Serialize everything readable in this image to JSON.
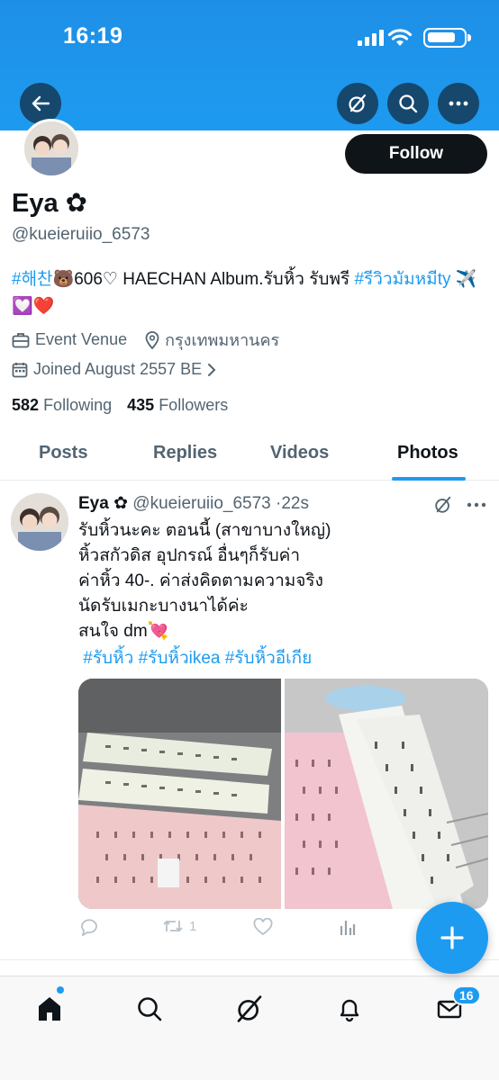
{
  "status_bar": {
    "time": "16:19",
    "battery_level": 0.78
  },
  "header": {
    "back_icon": "arrow-left-icon",
    "grok_icon": "grok-icon",
    "search_icon": "search-icon",
    "more_icon": "more-horizontal-icon"
  },
  "profile": {
    "follow_label": "Follow",
    "name": "Eya ✿",
    "handle": "@kueieruiio_6573",
    "bio": {
      "tag1": "#해찬",
      "text1": "🐻606♡ HAECHAN Album.รับหิ้ว รับพรี ",
      "tag2": "#รีวิวมัมหมีty",
      "text2": " ✈️💟❤️"
    },
    "category": "Event Venue",
    "location": "กรุงเทพมหานคร",
    "joined": "Joined August 2557 BE",
    "following_count": "582",
    "following_label": "Following",
    "followers_count": "435",
    "followers_label": "Followers"
  },
  "tabs": [
    {
      "label": "Posts"
    },
    {
      "label": "Replies"
    },
    {
      "label": "Videos"
    },
    {
      "label": "Photos",
      "active": true
    }
  ],
  "tweet": {
    "author_name": "Eya ✿",
    "author_handle": "@kueieruiio_6573",
    "separator": "·",
    "time": "22s",
    "text": "รับหิ้วนะคะ ตอนนี้ (สาขาบางใหญ่)\n หิ้วสกัวดิส  อุปกรณ์  อื่นๆก็รับค่า\nค่าหิ้ว 40-. ค่าส่งคิดตามความจริง\nนัดรับเมกะบางนาได้ค่ะ\nสนใจ dm💘",
    "hashtags": " #รับหิ้ว #รับหิ้วikea #รับหิ้วอีเกีย",
    "retweet_count": "1"
  },
  "bottom_nav": {
    "items": [
      "home-icon",
      "search-icon",
      "grok-icon",
      "notifications-icon",
      "messages-icon"
    ],
    "messages_badge": "16"
  },
  "colors": {
    "accent": "#1d9bf0",
    "text": "#0f1419",
    "secondary": "#536471"
  }
}
